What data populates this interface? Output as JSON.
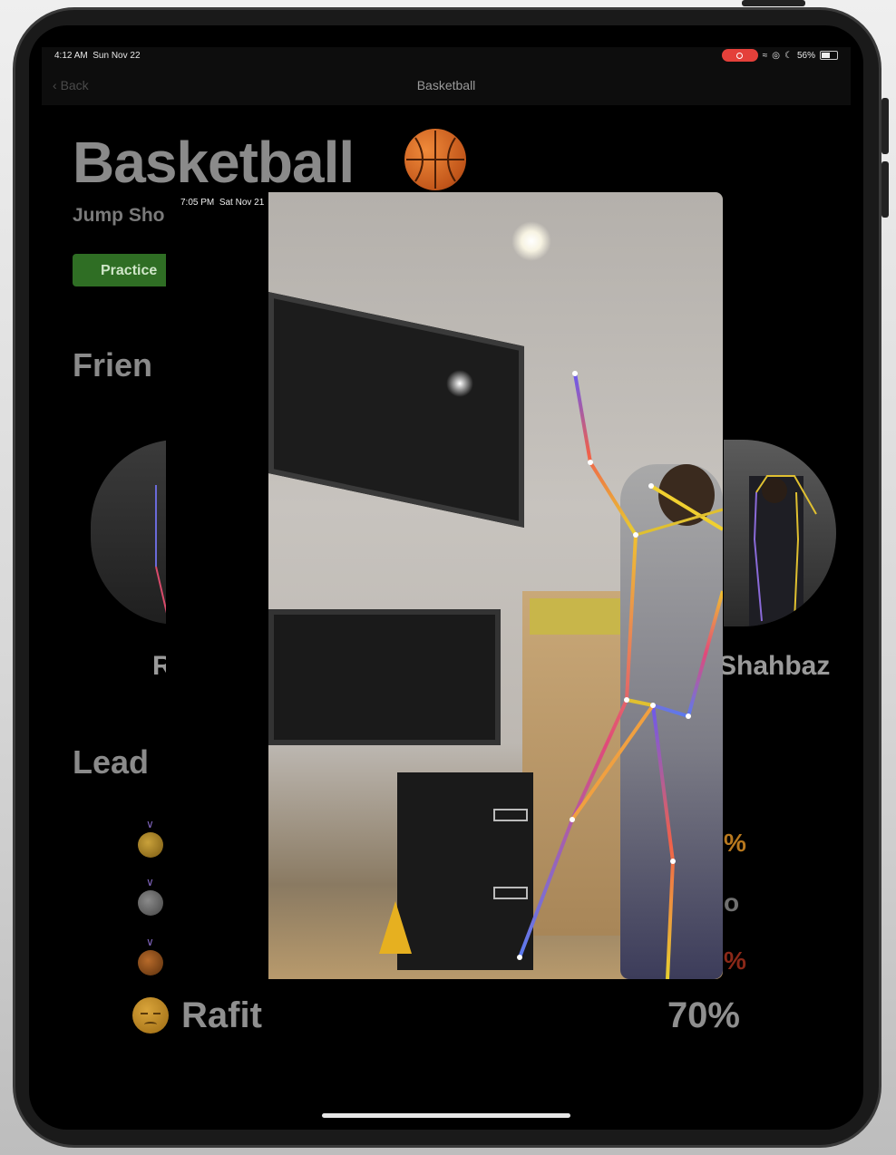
{
  "status_bar": {
    "time": "4:12 AM",
    "date": "Sun Nov 22",
    "battery": "56%",
    "battery_level": 0.56
  },
  "nav": {
    "back_label": "Back",
    "title": "Basketball"
  },
  "header": {
    "title": "Basketball",
    "subtitle": "Jump Sho",
    "practice_label": "Practice"
  },
  "sections": {
    "friends": "Frien",
    "leaderboard": "Lead"
  },
  "friends": [
    {
      "name": "R"
    },
    {
      "name": "Shahbaz"
    }
  ],
  "leaderboard": [
    {
      "rank_medal": "gold-medal-icon",
      "score_fragment": "%"
    },
    {
      "rank_medal": "silver-medal-icon",
      "score_fragment": "o"
    },
    {
      "rank_medal": "bronze-medal-icon",
      "score_fragment": "%"
    },
    {
      "emoji": "sad-face-icon",
      "name": "Rafit",
      "score": "70%"
    }
  ],
  "video_overlay": {
    "time": "7:05 PM",
    "date": "Sat Nov 21"
  },
  "colors": {
    "practice_button": "#2f6e24",
    "recording": "#e4403a"
  }
}
